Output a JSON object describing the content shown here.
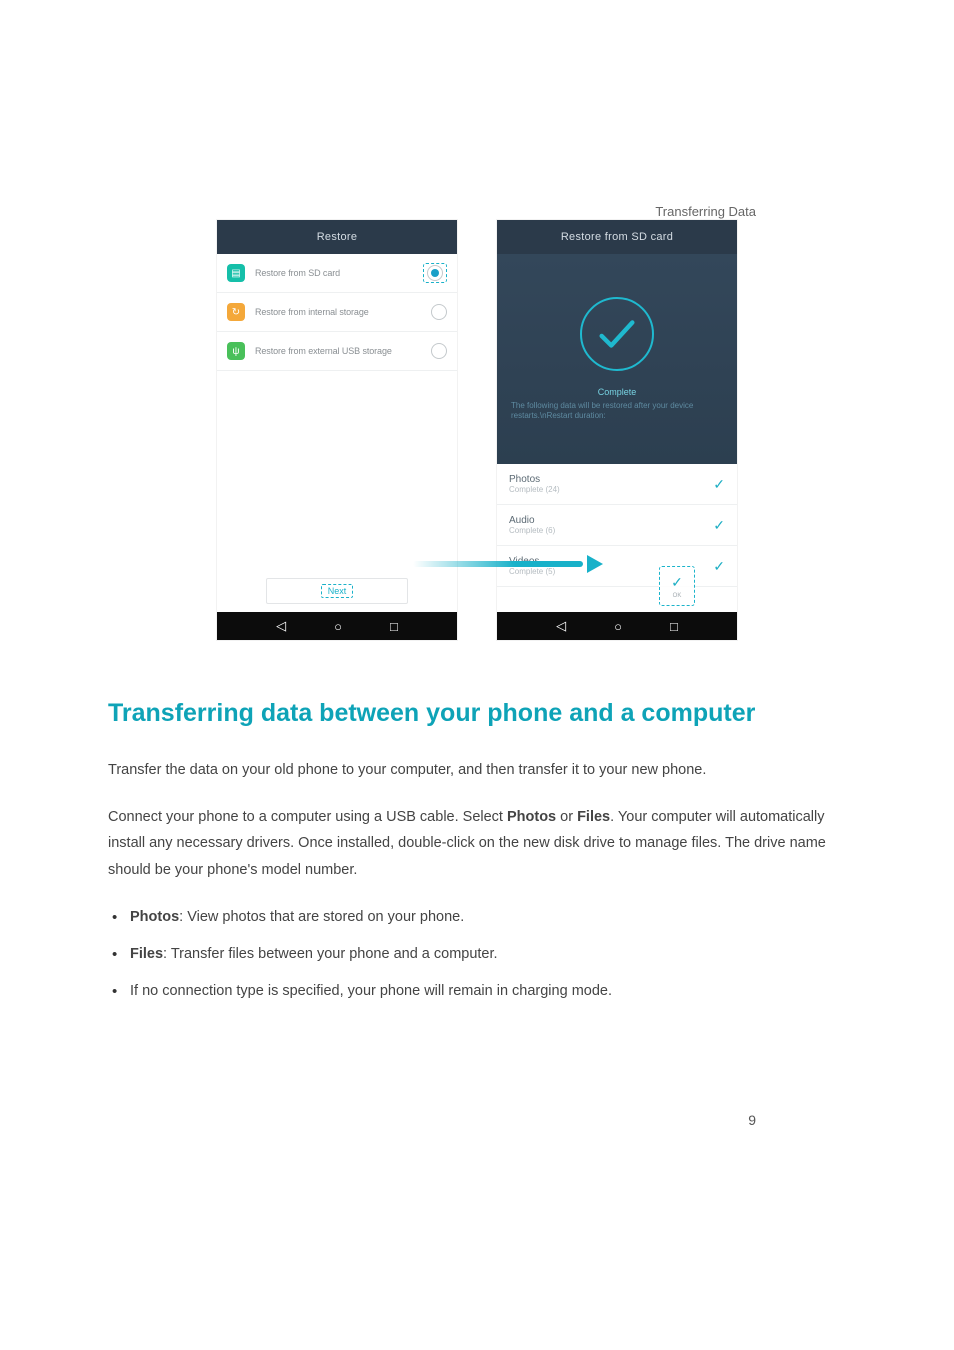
{
  "running_head": "Transferring Data",
  "page_number": "9",
  "left_phone": {
    "title": "Restore",
    "rows": [
      {
        "label": "Restore from SD card",
        "icon": "sd",
        "selected": true
      },
      {
        "label": "Restore from internal storage",
        "icon": "int",
        "selected": false
      },
      {
        "label": "Restore from external USB storage",
        "icon": "usb",
        "selected": false
      }
    ],
    "next": "Next"
  },
  "right_phone": {
    "title": "Restore from SD card",
    "complete": "Complete",
    "complete_desc": "The following data will be restored after your device restarts.\\nRestart duration:",
    "items": [
      {
        "name": "Photos",
        "sub": "Complete (24)"
      },
      {
        "name": "Audio",
        "sub": "Complete (6)"
      },
      {
        "name": "Videos",
        "sub": "Complete (5)"
      }
    ],
    "annot": "OK"
  },
  "heading": "Transferring data between your phone and a computer",
  "para1": "Transfer the data on your old phone to your computer, and then transfer it to your new phone.",
  "para2_a": "Connect your phone to a computer using a USB cable. Select ",
  "para2_b": "Photos",
  "para2_c": " or ",
  "para2_d": "Files",
  "para2_e": ". Your computer will automatically install any necessary drivers. Once installed, double-click on the new disk drive to manage files. The drive name should be your phone's model number.",
  "bullets": {
    "b1_label": "Photos",
    "b1_text": ": View photos that are stored on your phone.",
    "b2_label": "Files",
    "b2_text": ": Transfer files between your phone and a computer.",
    "b3_text": "If no connection type is specified, your phone will remain in charging mode."
  }
}
